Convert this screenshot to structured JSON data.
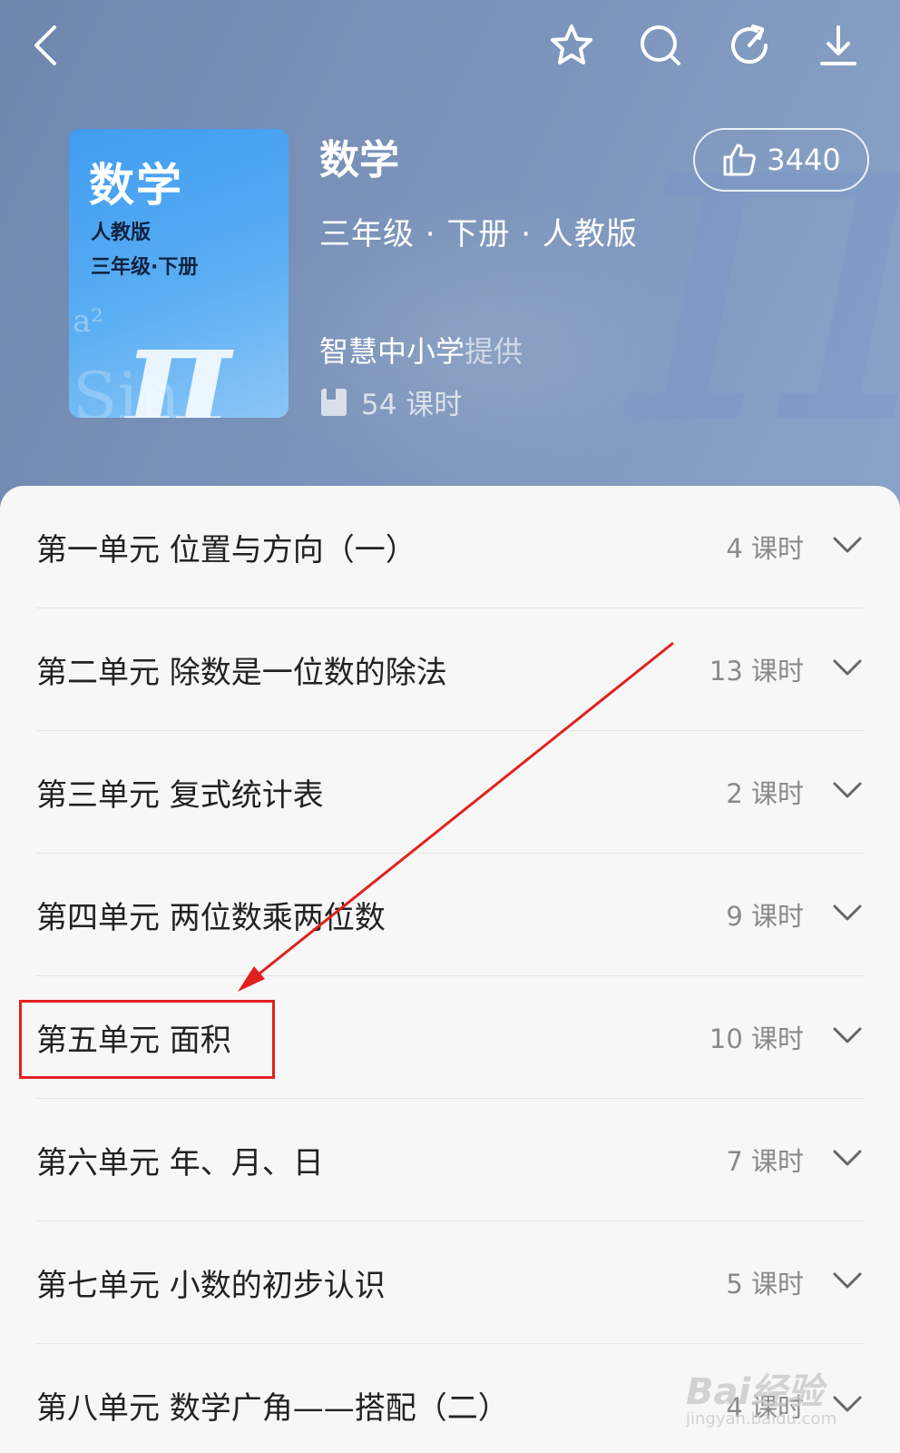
{
  "header": {
    "book_title": "数学",
    "meta": "三年级 · 下册 · 人教版",
    "provider_name": "智慧中小学",
    "provider_suffix": "提供",
    "hours": "54 课时",
    "like_count": "3440",
    "icons": [
      "back-icon",
      "star-icon",
      "search-icon",
      "refresh-icon",
      "download-icon"
    ]
  },
  "cover": {
    "title": "数学",
    "edition": "人教版",
    "grade": "三年级·下册",
    "pi_symbol": "π",
    "sin_text": "Sin",
    "power_text": "a²"
  },
  "units": [
    {
      "title": "第一单元 位置与方向（一）",
      "hours": "4 课时"
    },
    {
      "title": "第二单元 除数是一位数的除法",
      "hours": "13 课时"
    },
    {
      "title": "第三单元 复式统计表",
      "hours": "2 课时"
    },
    {
      "title": "第四单元 两位数乘两位数",
      "hours": "9 课时"
    },
    {
      "title": "第五单元 面积",
      "hours": "10 课时"
    },
    {
      "title": "第六单元 年、月、日",
      "hours": "7 课时"
    },
    {
      "title": "第七单元 小数的初步认识",
      "hours": "5 课时"
    },
    {
      "title": "第八单元 数学广角——搭配（二）",
      "hours": "4 课时"
    }
  ],
  "watermark": {
    "main": "Bai经验",
    "sub": "jingyan.baidu.com"
  },
  "colors": {
    "header_bg": "#7b93ba",
    "cover_bg": "#4ea4f2",
    "annotation_red": "#e0211e"
  }
}
